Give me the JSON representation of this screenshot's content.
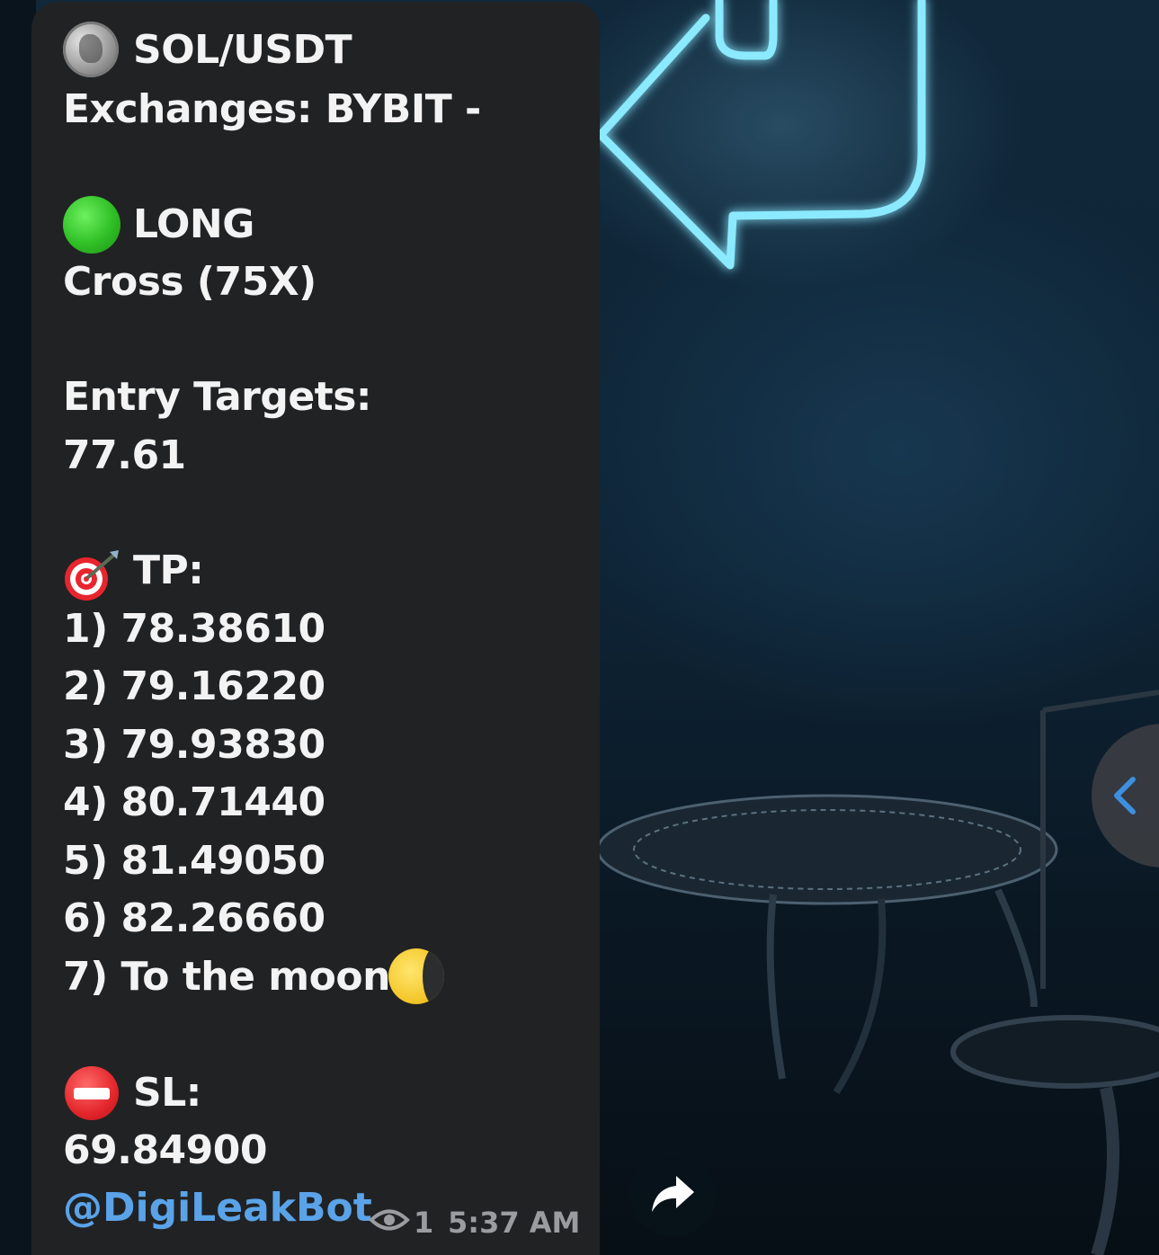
{
  "message": {
    "pair": "SOL/USDT",
    "exchanges": "Exchanges: BYBIT -",
    "direction": "LONG",
    "margin": "Cross (75X)",
    "entry_label": "Entry Targets:",
    "entry_value": "77.61",
    "tp_label": "TP:",
    "tp_targets": [
      "1) 78.38610",
      "2) 79.16220",
      "3) 79.93830",
      "4) 80.71440",
      "5) 81.49050",
      "6) 82.26660",
      "7) To the moon"
    ],
    "sl_label": "SL:",
    "sl_value": "69.84900",
    "bot_link": "@DigiLeakBot",
    "views": "1",
    "time": "5:37 AM"
  },
  "icons": {
    "coin": "solana-coin-icon",
    "long": "green-circle-icon",
    "tp": "direct-hit-target-icon",
    "moon": "moon-icon",
    "sl": "no-entry-icon",
    "views": "eye-icon",
    "share": "share-arrow-icon",
    "side_tab": "chevron-left-icon"
  },
  "colors": {
    "bubble": "#212224",
    "text": "#f3f3f3",
    "link": "#5aa3e8",
    "meta": "#9a9c9f",
    "accent_neon": "#7fe6ff"
  }
}
